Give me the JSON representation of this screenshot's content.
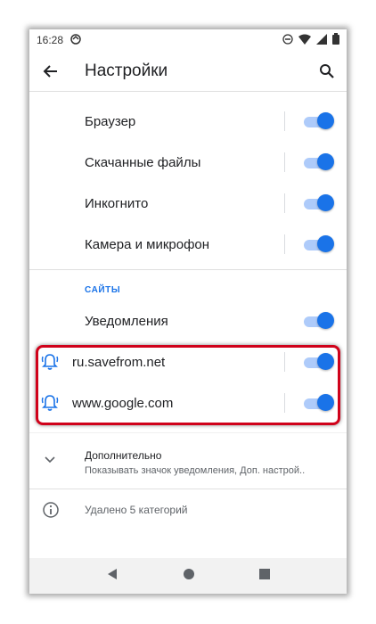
{
  "status_bar": {
    "time": "16:28"
  },
  "app_bar": {
    "title": "Настройки"
  },
  "main_toggles": [
    {
      "label": "Браузер",
      "on": true
    },
    {
      "label": "Скачанные файлы",
      "on": true
    },
    {
      "label": "Инкогнито",
      "on": true
    },
    {
      "label": "Камера и микрофон",
      "on": true
    }
  ],
  "sites_section": {
    "header": "САЙТЫ",
    "notifications": {
      "label": "Уведомления",
      "on": true
    },
    "sites": [
      {
        "label": "ru.savefrom.net",
        "on": true,
        "icon": "bell-icon"
      },
      {
        "label": "www.google.com",
        "on": true,
        "icon": "bell-icon"
      }
    ]
  },
  "advanced": {
    "title": "Дополнительно",
    "subtitle": "Показывать значок уведомления, Доп. настрой.."
  },
  "deleted": {
    "text": "Удалено 5 категорий"
  },
  "colors": {
    "accent": "#1a73e8",
    "highlight": "#d0021b"
  }
}
